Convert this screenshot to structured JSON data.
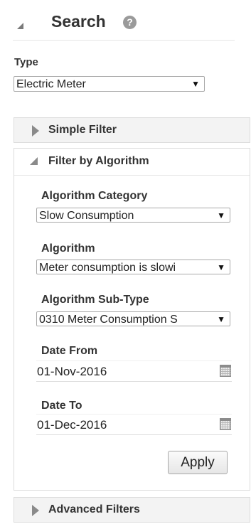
{
  "header": {
    "title": "Search",
    "help_glyph": "?"
  },
  "type_field": {
    "label": "Type",
    "value": "Electric Meter"
  },
  "panels": {
    "simple_filter": "Simple Filter",
    "filter_by_algorithm": "Filter by Algorithm",
    "advanced_filters": "Advanced Filters"
  },
  "algorithm_filter": {
    "category_label": "Algorithm Category",
    "category_value": "Slow Consumption",
    "algorithm_label": "Algorithm",
    "algorithm_value": "Meter consumption is slowi",
    "subtype_label": "Algorithm Sub-Type",
    "subtype_value": "0310 Meter Consumption S",
    "date_from_label": "Date From",
    "date_from_value": "01-Nov-2016",
    "date_to_label": "Date To",
    "date_to_value": "01-Dec-2016",
    "apply_label": "Apply"
  },
  "icons": {
    "collapse": "triangle-down-icon",
    "expand": "triangle-right-icon",
    "help": "help-icon",
    "calendar": "calendar-icon",
    "dropdown": "dropdown-arrow-icon"
  },
  "colors": {
    "panel_bg": "#f3f3f3",
    "help_icon_bg": "#9a9a9a",
    "text": "#333333"
  }
}
